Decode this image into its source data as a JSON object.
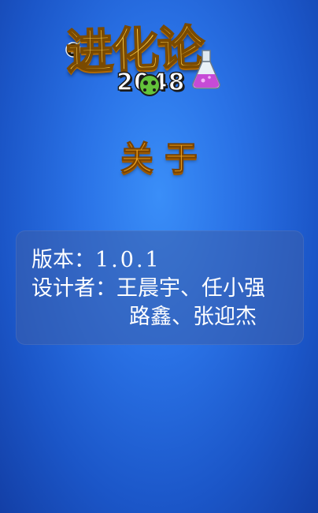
{
  "logo": {
    "title": "进化论",
    "number": "2048",
    "icons": [
      "bomb-icon",
      "potion-flask-icon",
      "green-blob-icon"
    ]
  },
  "heading": "关于",
  "info": {
    "version_label": "版本：",
    "version_value": "1.0.1",
    "designers_label": "设计者：",
    "designers_line1": "王晨宇、任小强",
    "designers_line2": "路鑫、张迎杰"
  },
  "colors": {
    "background": "#2a72e6",
    "heading": "#f2a41c",
    "logo_title": "#ffd24a",
    "panel": "#3c5faa",
    "text": "#ffffff"
  }
}
